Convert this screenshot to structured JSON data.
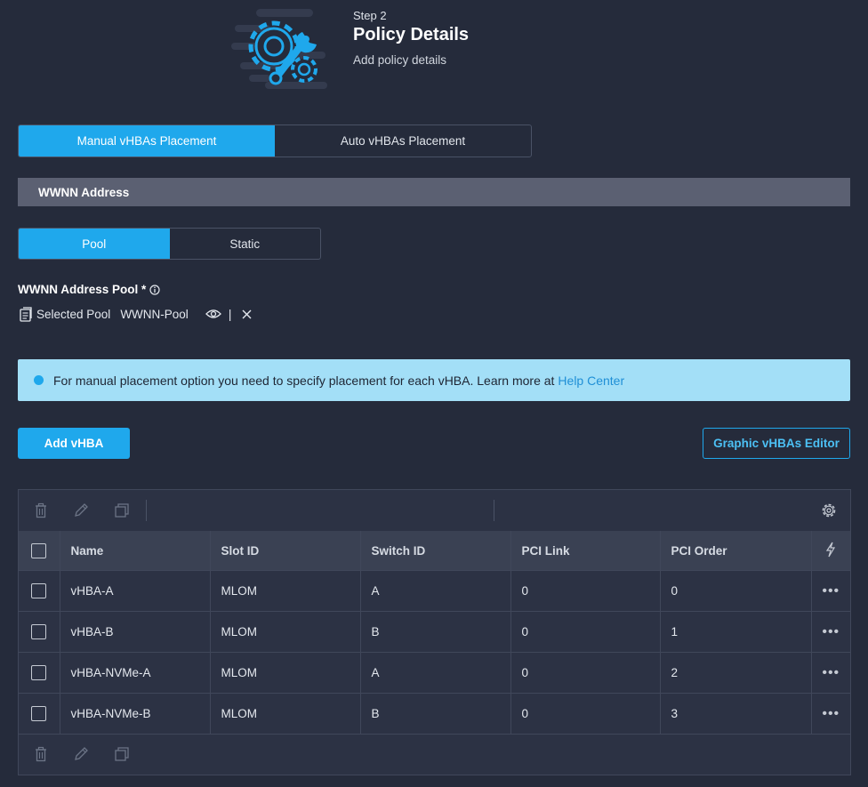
{
  "header": {
    "icon": "gear-wrench-icon",
    "step": "Step 2",
    "title": "Policy Details",
    "subtitle": "Add policy details"
  },
  "placement_tabs": {
    "options": [
      "Manual vHBAs Placement",
      "Auto vHBAs Placement"
    ],
    "selected": "Manual vHBAs Placement"
  },
  "section": {
    "title": "WWNN Address"
  },
  "pool_toggle": {
    "options": [
      "Pool",
      "Static"
    ],
    "selected": "Pool"
  },
  "pool_field": {
    "label": "WWNN Address Pool *",
    "selected_prefix": "Selected Pool",
    "selected_value": "WWNN-Pool",
    "separator": "|"
  },
  "info": {
    "message": "For manual placement option you need to specify placement for each vHBA. Learn more at",
    "link": "Help Center"
  },
  "actions": {
    "add": "Add vHBA",
    "editor": "Graphic vHBAs Editor"
  },
  "table": {
    "columns": [
      "Name",
      "Slot ID",
      "Switch ID",
      "PCI Link",
      "PCI Order"
    ],
    "rows": [
      {
        "name": "vHBA-A",
        "slot": "MLOM",
        "switch": "A",
        "pci_link": "0",
        "pci_order": "0"
      },
      {
        "name": "vHBA-B",
        "slot": "MLOM",
        "switch": "B",
        "pci_link": "0",
        "pci_order": "1"
      },
      {
        "name": "vHBA-NVMe-A",
        "slot": "MLOM",
        "switch": "A",
        "pci_link": "0",
        "pci_order": "2"
      },
      {
        "name": "vHBA-NVMe-B",
        "slot": "MLOM",
        "switch": "B",
        "pci_link": "0",
        "pci_order": "3"
      }
    ],
    "row_menu": "•••"
  },
  "colors": {
    "background": "#252b3b",
    "accent": "#1fa8ec",
    "section_bar": "#5b6072",
    "info_banner": "#a3dff7"
  }
}
